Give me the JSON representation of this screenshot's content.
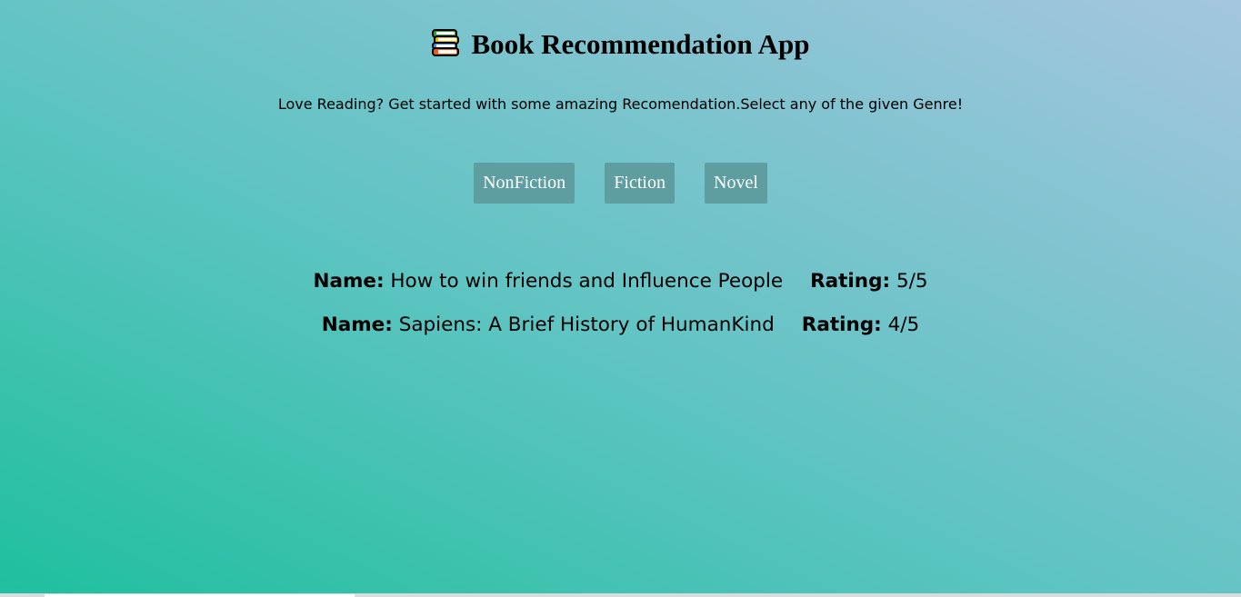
{
  "header": {
    "title": "Book Recommendation App",
    "icon": "books-icon"
  },
  "subtitle": "Love Reading? Get started with some amazing Recomendation.Select any of the given Genre!",
  "genres": [
    "NonFiction",
    "Fiction",
    "Novel"
  ],
  "books": [
    {
      "name_label": "Name:",
      "name": "How to win friends and Influence People",
      "rating_label": "Rating:",
      "rating": "5/5"
    },
    {
      "name_label": "Name:",
      "name": "Sapiens: A Brief History of HumanKind",
      "rating_label": "Rating:",
      "rating": "4/5"
    }
  ]
}
